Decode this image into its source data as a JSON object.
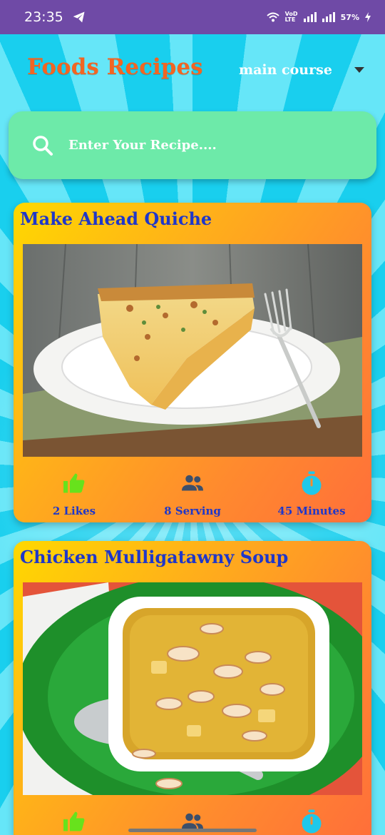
{
  "status_bar": {
    "time": "23:35",
    "telegram_icon": "telegram-icon",
    "network_label": "VoD LTE",
    "battery": "57%"
  },
  "header": {
    "title": "Foods Recipes",
    "category": "main course",
    "title_color": "#f26522"
  },
  "search": {
    "placeholder": "Enter Your Recipe....",
    "icon": "search-icon"
  },
  "recipes": [
    {
      "title": "Make Ahead Quiche",
      "likes": "2 Likes",
      "serving": "8 Serving",
      "time": "45 Minutes"
    },
    {
      "title": "Chicken Mulligatawny Soup"
    }
  ],
  "colors": {
    "card_title": "#1f37c9",
    "like_icon": "#67e21c",
    "serving_icon": "#3d4f6a",
    "timer_icon": "#1ec8ea",
    "search_bar": "#6deaa9",
    "status_bar": "#6f4aa6"
  }
}
